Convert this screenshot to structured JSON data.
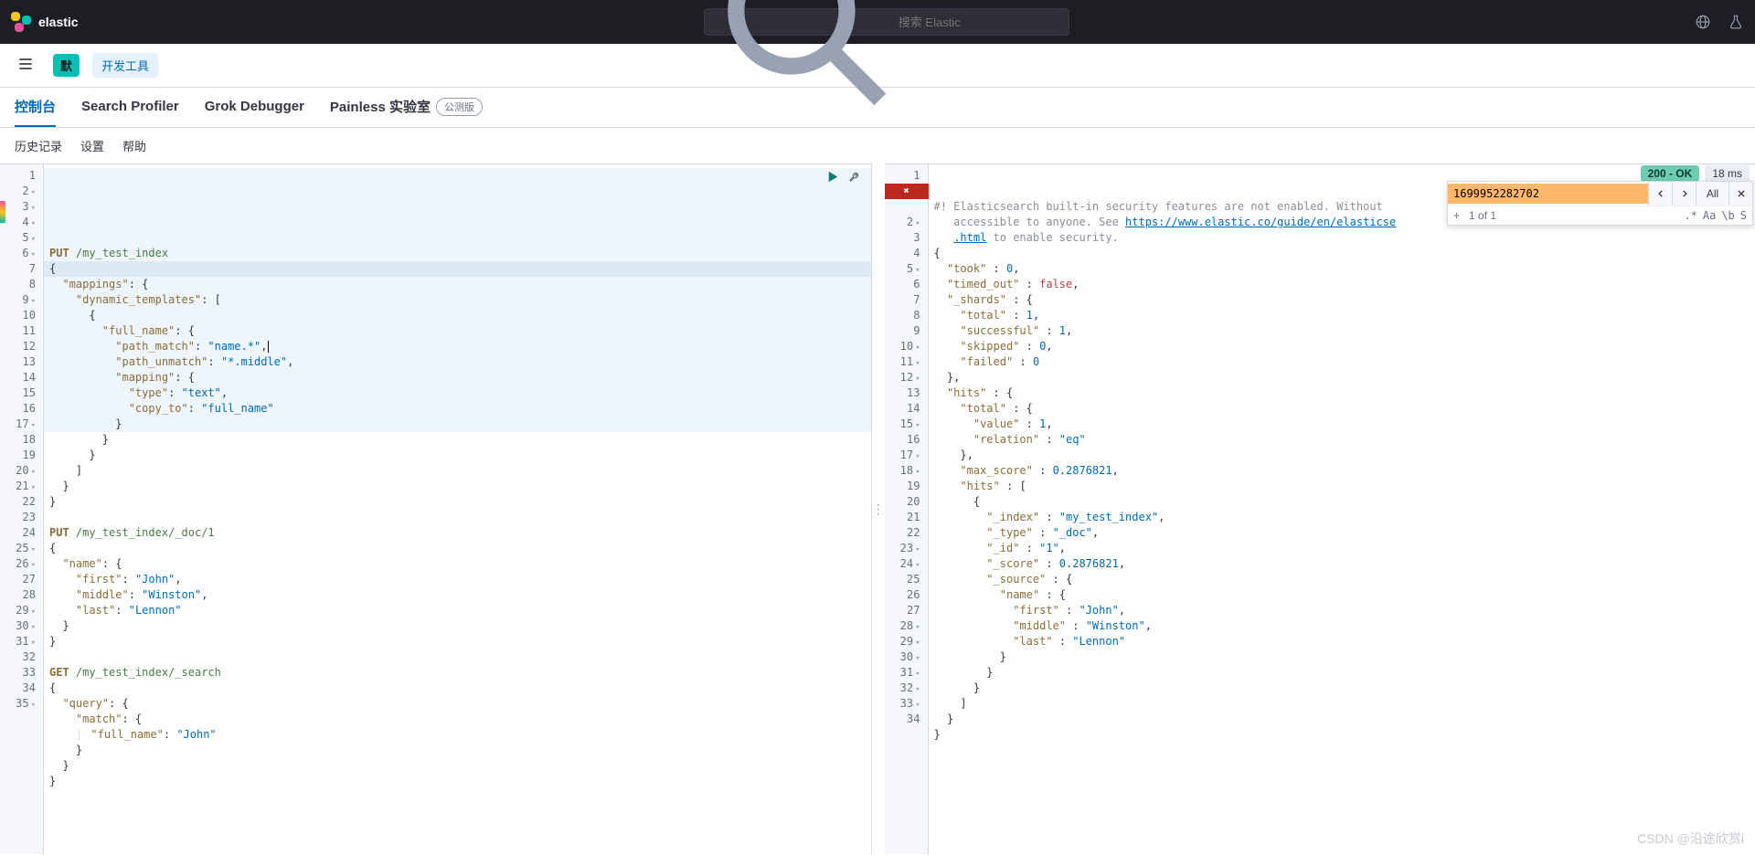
{
  "header": {
    "brand": "elastic",
    "search_placeholder": "搜索 Elastic"
  },
  "subheader": {
    "badge": "默",
    "devtools": "开发工具"
  },
  "tabs": {
    "console": "控制台",
    "profiler": "Search Profiler",
    "grok": "Grok Debugger",
    "painless": "Painless 实验室",
    "beta": "公测版"
  },
  "toolbar": {
    "history": "历史记录",
    "settings": "设置",
    "help": "帮助"
  },
  "status": {
    "code": "200 - OK",
    "time": "18 ms"
  },
  "find": {
    "value": "1699952282702",
    "count": "1 of 1",
    "all": "All",
    "regex": ".*",
    "case": "Aa",
    "word": "\\b",
    "sel": "S",
    "plus": "+"
  },
  "request": {
    "lines": [
      {
        "n": 1,
        "fold": false,
        "html": "<span class='kw'>PUT</span> <span class='strg'>/my_test_index</span>"
      },
      {
        "n": 2,
        "fold": true,
        "html": "{"
      },
      {
        "n": 3,
        "fold": true,
        "html": "  <span class='prop'>\"mappings\"</span>: {"
      },
      {
        "n": 4,
        "fold": true,
        "html": "    <span class='prop'>\"dynamic_templates\"</span>: ["
      },
      {
        "n": 5,
        "fold": true,
        "html": "      {"
      },
      {
        "n": 6,
        "fold": true,
        "html": "        <span class='prop'>\"full_name\"</span>: {"
      },
      {
        "n": 7,
        "fold": false,
        "html": "          <span class='prop'>\"path_match\"</span>: <span class='str'>\"name.*\"</span>,<span class='cursor'></span>"
      },
      {
        "n": 8,
        "fold": false,
        "html": "          <span class='prop'>\"path_unmatch\"</span>: <span class='str'>\"*.middle\"</span>,"
      },
      {
        "n": 9,
        "fold": true,
        "html": "          <span class='prop'>\"mapping\"</span>: {"
      },
      {
        "n": 10,
        "fold": false,
        "html": "            <span class='prop'>\"type\"</span>: <span class='str'>\"text\"</span>,"
      },
      {
        "n": 11,
        "fold": false,
        "html": "            <span class='prop'>\"copy_to\"</span>: <span class='str'>\"full_name\"</span>"
      },
      {
        "n": 12,
        "fold": false,
        "html": "          }"
      },
      {
        "n": 13,
        "fold": false,
        "html": "        }"
      },
      {
        "n": 14,
        "fold": false,
        "html": "      }"
      },
      {
        "n": 15,
        "fold": false,
        "html": "    ]"
      },
      {
        "n": 16,
        "fold": false,
        "html": "  }"
      },
      {
        "n": 17,
        "fold": true,
        "html": "}"
      },
      {
        "n": 18,
        "fold": false,
        "html": ""
      },
      {
        "n": 19,
        "fold": false,
        "html": "<span class='kw'>PUT</span> <span class='strg'>/my_test_index/_doc/1</span>"
      },
      {
        "n": 20,
        "fold": true,
        "html": "{"
      },
      {
        "n": 21,
        "fold": true,
        "html": "  <span class='prop'>\"name\"</span>: {"
      },
      {
        "n": 22,
        "fold": false,
        "html": "    <span class='prop'>\"first\"</span>: <span class='str'>\"John\"</span>,"
      },
      {
        "n": 23,
        "fold": false,
        "html": "    <span class='prop'>\"middle\"</span>: <span class='str'>\"Winston\"</span>,"
      },
      {
        "n": 24,
        "fold": false,
        "html": "    <span class='prop'>\"last\"</span>: <span class='str'>\"Lennon\"</span>"
      },
      {
        "n": 25,
        "fold": true,
        "html": "  }"
      },
      {
        "n": 26,
        "fold": true,
        "html": "}"
      },
      {
        "n": 27,
        "fold": false,
        "html": ""
      },
      {
        "n": 28,
        "fold": false,
        "html": "<span class='kw'>GET</span> <span class='strg'>/my_test_index/_search</span>"
      },
      {
        "n": 29,
        "fold": true,
        "html": "{"
      },
      {
        "n": 30,
        "fold": true,
        "html": "  <span class='prop'>\"query\"</span>: {"
      },
      {
        "n": 31,
        "fold": true,
        "html": "    <span class='prop'>\"match\"</span>: {"
      },
      {
        "n": 32,
        "fold": false,
        "html": "    <span class='pipe'>|</span> <span class='prop'>\"full_name\"</span>: <span class='str'>\"John\"</span>"
      },
      {
        "n": 33,
        "fold": false,
        "html": "    }"
      },
      {
        "n": 34,
        "fold": false,
        "html": "  }"
      },
      {
        "n": 35,
        "fold": true,
        "html": "}"
      }
    ]
  },
  "response": {
    "lines": [
      {
        "n": 1,
        "fold": false,
        "html": "<span class='comm'>#! Elasticsearch built-in security features are not enabled. Without </span>"
      },
      {
        "n": "",
        "fold": false,
        "html": "<span class='comm'>   accessible to anyone. See </span><span class='url'>https://www.elastic.co/guide/en/elasticse</span>"
      },
      {
        "n": "",
        "fold": false,
        "html": "<span class='comm'>   </span><span class='url'>.html</span><span class='comm'> to enable security.</span>"
      },
      {
        "n": 2,
        "fold": true,
        "html": "{"
      },
      {
        "n": 3,
        "fold": false,
        "html": "  <span class='prop'>\"took\"</span> : <span class='num'>0</span>,"
      },
      {
        "n": 4,
        "fold": false,
        "html": "  <span class='prop'>\"timed_out\"</span> : <span class='bool'>false</span>,"
      },
      {
        "n": 5,
        "fold": true,
        "html": "  <span class='prop'>\"_shards\"</span> : {"
      },
      {
        "n": 6,
        "fold": false,
        "html": "    <span class='prop'>\"total\"</span> : <span class='num'>1</span>,"
      },
      {
        "n": 7,
        "fold": false,
        "html": "    <span class='prop'>\"successful\"</span> : <span class='num'>1</span>,"
      },
      {
        "n": 8,
        "fold": false,
        "html": "    <span class='prop'>\"skipped\"</span> : <span class='num'>0</span>,"
      },
      {
        "n": 9,
        "fold": false,
        "html": "    <span class='prop'>\"failed\"</span> : <span class='num'>0</span>"
      },
      {
        "n": 10,
        "fold": true,
        "html": "  },"
      },
      {
        "n": 11,
        "fold": true,
        "html": "  <span class='prop'>\"hits\"</span> : {"
      },
      {
        "n": 12,
        "fold": true,
        "html": "    <span class='prop'>\"total\"</span> : {"
      },
      {
        "n": 13,
        "fold": false,
        "html": "      <span class='prop'>\"value\"</span> : <span class='num'>1</span>,"
      },
      {
        "n": 14,
        "fold": false,
        "html": "      <span class='prop'>\"relation\"</span> : <span class='str'>\"eq\"</span>"
      },
      {
        "n": 15,
        "fold": true,
        "html": "    },"
      },
      {
        "n": 16,
        "fold": false,
        "html": "    <span class='prop'>\"max_score\"</span> : <span class='num'>0.2876821</span>,"
      },
      {
        "n": 17,
        "fold": true,
        "html": "    <span class='prop'>\"hits\"</span> : ["
      },
      {
        "n": 18,
        "fold": true,
        "html": "      {"
      },
      {
        "n": 19,
        "fold": false,
        "html": "        <span class='prop'>\"_index\"</span> : <span class='str'>\"my_test_index\"</span>,"
      },
      {
        "n": 20,
        "fold": false,
        "html": "        <span class='prop'>\"_type\"</span> : <span class='str'>\"_doc\"</span>,"
      },
      {
        "n": 21,
        "fold": false,
        "html": "        <span class='prop'>\"_id\"</span> : <span class='str'>\"1\"</span>,"
      },
      {
        "n": 22,
        "fold": false,
        "html": "        <span class='prop'>\"_score\"</span> : <span class='num'>0.2876821</span>,"
      },
      {
        "n": 23,
        "fold": true,
        "html": "        <span class='prop'>\"_source\"</span> : {"
      },
      {
        "n": 24,
        "fold": true,
        "html": "          <span class='prop'>\"name\"</span> : {"
      },
      {
        "n": 25,
        "fold": false,
        "html": "            <span class='prop'>\"first\"</span> : <span class='str'>\"John\"</span>,"
      },
      {
        "n": 26,
        "fold": false,
        "html": "            <span class='prop'>\"middle\"</span> : <span class='str'>\"Winston\"</span>,"
      },
      {
        "n": 27,
        "fold": false,
        "html": "            <span class='prop'>\"last\"</span> : <span class='str'>\"Lennon\"</span>"
      },
      {
        "n": 28,
        "fold": true,
        "html": "          }"
      },
      {
        "n": 29,
        "fold": true,
        "html": "        }"
      },
      {
        "n": 30,
        "fold": true,
        "html": "      }"
      },
      {
        "n": 31,
        "fold": true,
        "html": "    ]"
      },
      {
        "n": 32,
        "fold": true,
        "html": "  }"
      },
      {
        "n": 33,
        "fold": true,
        "html": "}"
      },
      {
        "n": 34,
        "fold": false,
        "html": ""
      }
    ]
  },
  "watermark": "CSDN @沿途欣赏i"
}
